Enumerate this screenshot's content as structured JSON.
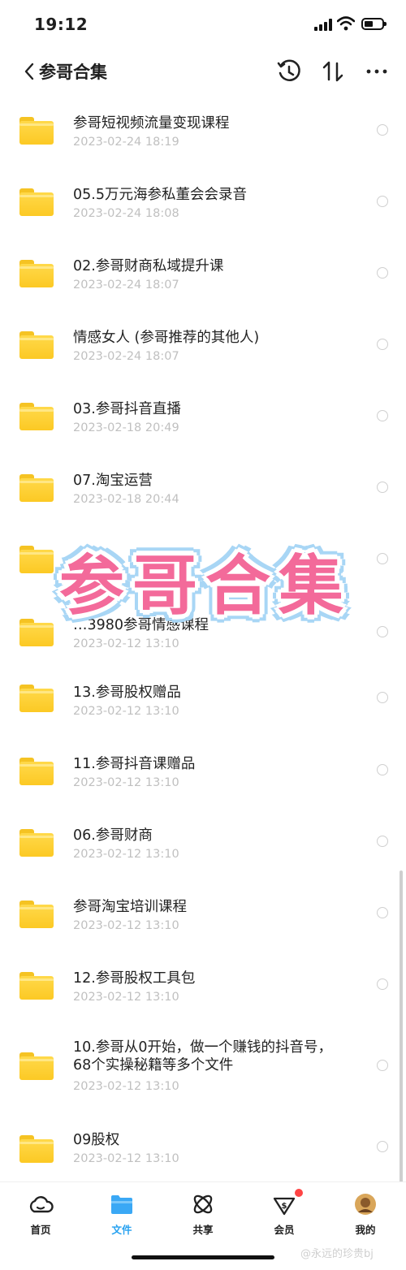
{
  "status": {
    "time": "19:12"
  },
  "header": {
    "title": "参哥合集"
  },
  "files": [
    {
      "name": "参哥短视频流量变现课程",
      "date": "2023-02-24 18:19"
    },
    {
      "name": "05.5万元海参私董会会录音",
      "date": "2023-02-24 18:08"
    },
    {
      "name": "02.参哥财商私域提升课",
      "date": "2023-02-24 18:07"
    },
    {
      "name": "情感女人 (参哥推荐的其他人)",
      "date": "2023-02-24 18:07"
    },
    {
      "name": "03.参哥抖音直播",
      "date": "2023-02-18 20:49"
    },
    {
      "name": "07.淘宝运营",
      "date": "2023-02-18 20:44"
    },
    {
      "name": "",
      "date": ""
    },
    {
      "name": "…3980参哥情感课程",
      "date": "2023-02-12 13:10"
    },
    {
      "name": "13.参哥股权赠品",
      "date": "2023-02-12 13:10"
    },
    {
      "name": "11.参哥抖音课赠品",
      "date": "2023-02-12 13:10"
    },
    {
      "name": "06.参哥财商",
      "date": "2023-02-12 13:10"
    },
    {
      "name": "参哥淘宝培训课程",
      "date": "2023-02-12 13:10"
    },
    {
      "name": "12.参哥股权工具包",
      "date": "2023-02-12 13:10"
    },
    {
      "name": "10.参哥从0开始，做一个赚钱的抖音号，68个实操秘籍等多个文件",
      "date": "2023-02-12 13:10"
    },
    {
      "name": "09股权",
      "date": "2023-02-12 13:10"
    }
  ],
  "overlay": {
    "text": "参哥合集"
  },
  "tabbar": {
    "items": [
      {
        "label": "首页",
        "icon": "cloud-home-icon"
      },
      {
        "label": "文件",
        "icon": "folder-icon"
      },
      {
        "label": "共享",
        "icon": "share-atom-icon"
      },
      {
        "label": "会员",
        "icon": "vip-diamond-icon"
      },
      {
        "label": "我的",
        "icon": "avatar-icon"
      }
    ],
    "active": "文件"
  },
  "watermark": "@永远的珍贵bj",
  "colors": {
    "accent": "#28a2f0",
    "folder": "#fcc924",
    "overlay_pink": "#f36a9a",
    "overlay_outline": "#a8d6f5",
    "badge": "#ff4444"
  }
}
